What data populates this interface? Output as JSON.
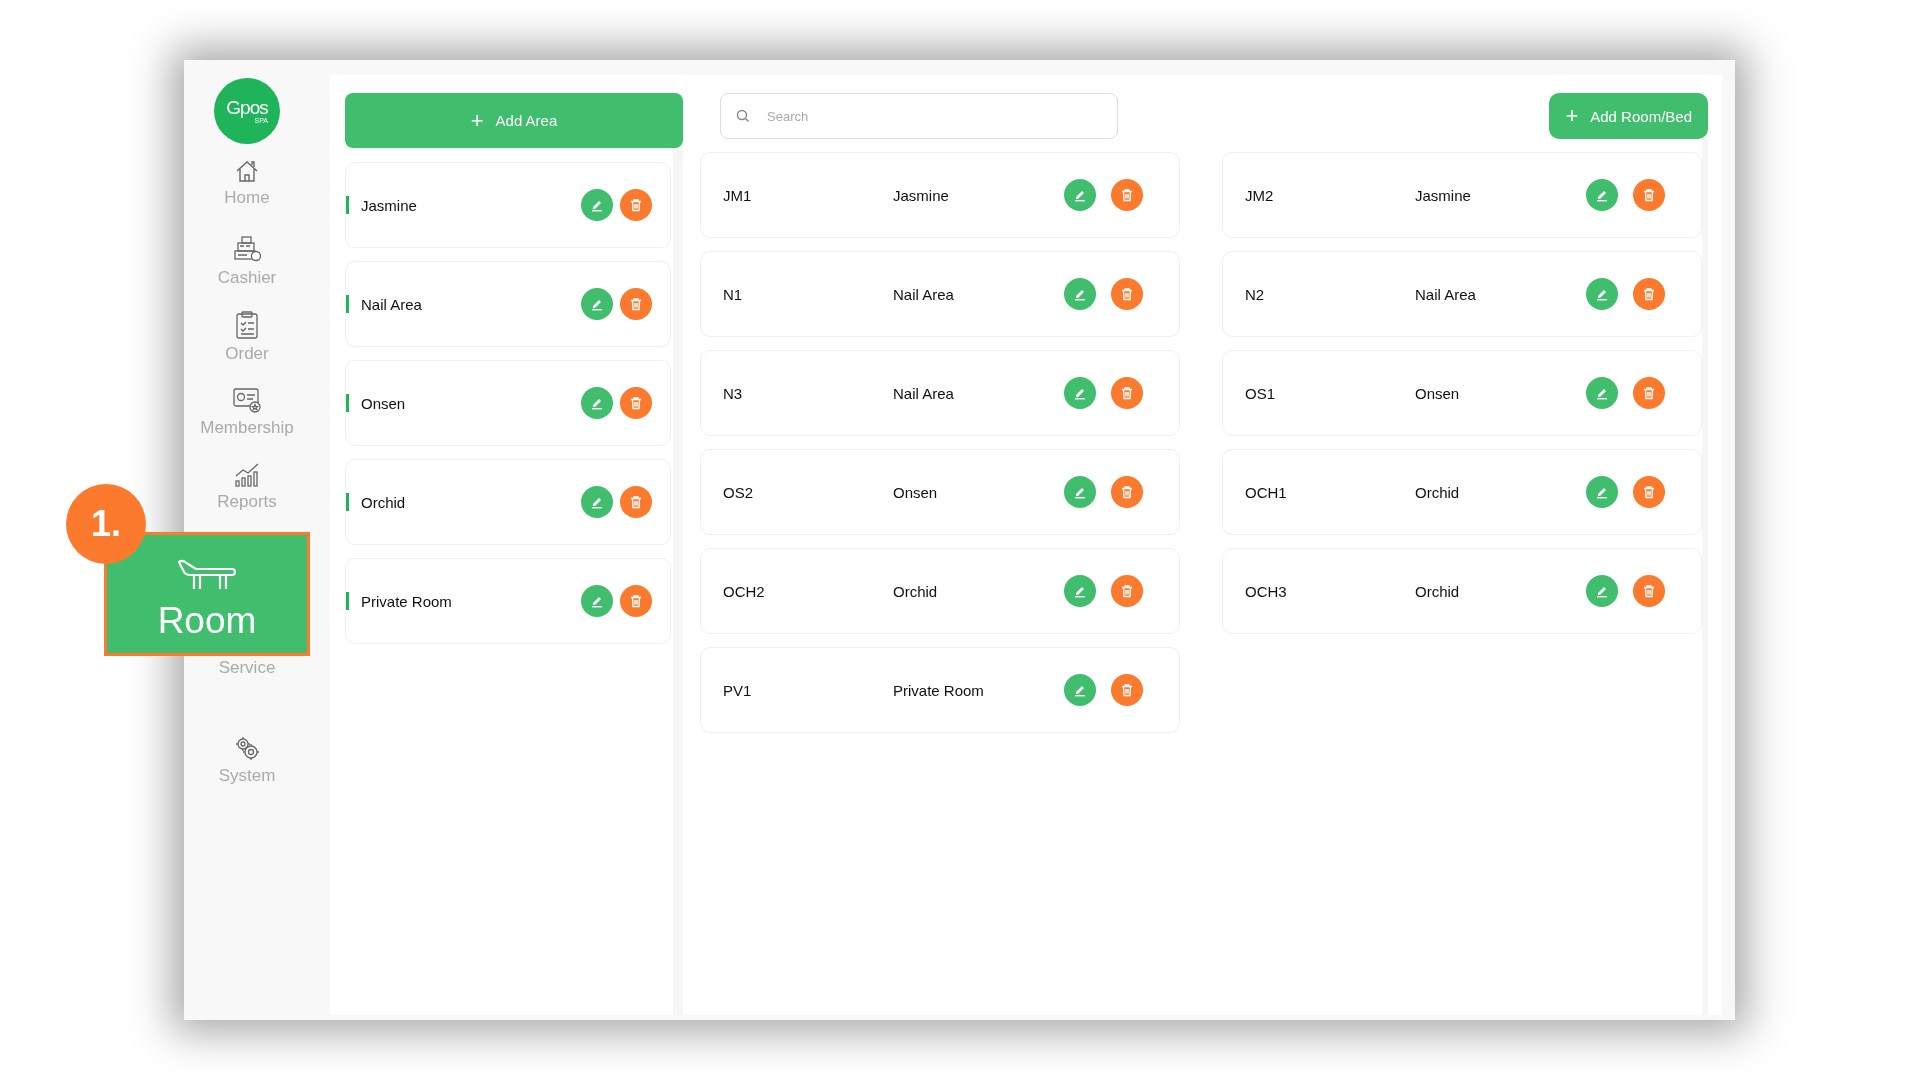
{
  "sidebar": {
    "logo": {
      "name": "Gpos",
      "tag": "SPA"
    },
    "items": [
      {
        "label": "Home",
        "kind": "home",
        "selected": false
      },
      {
        "label": "Cashier",
        "kind": "cashier",
        "selected": false
      },
      {
        "label": "Order",
        "kind": "order",
        "selected": false
      },
      {
        "label": "Membership",
        "kind": "membership",
        "selected": false
      },
      {
        "label": "Reports",
        "kind": "reports",
        "selected": false
      },
      {
        "label": "Room",
        "kind": "room",
        "selected": true
      },
      {
        "label": "Service",
        "kind": "service",
        "selected": false
      },
      {
        "label": "System",
        "kind": "system",
        "selected": false
      }
    ]
  },
  "callout": {
    "number": "1."
  },
  "add_area_button": {
    "label": "Add Area",
    "icon": "+"
  },
  "search": {
    "placeholder": "Search"
  },
  "add_room_button": {
    "label": "Add Room/Bed",
    "icon": "+"
  },
  "areas": [
    {
      "name": "Jasmine"
    },
    {
      "name": "Nail Area"
    },
    {
      "name": "Onsen"
    },
    {
      "name": "Orchid"
    },
    {
      "name": "Private Room"
    }
  ],
  "rooms": [
    {
      "code": "JM1",
      "area": "Jasmine"
    },
    {
      "code": "JM2",
      "area": "Jasmine"
    },
    {
      "code": "N1",
      "area": "Nail Area"
    },
    {
      "code": "N2",
      "area": "Nail Area"
    },
    {
      "code": "N3",
      "area": "Nail Area"
    },
    {
      "code": "OS1",
      "area": "Onsen"
    },
    {
      "code": "OS2",
      "area": "Onsen"
    },
    {
      "code": "OCH1",
      "area": "Orchid"
    },
    {
      "code": "OCH2",
      "area": "Orchid"
    },
    {
      "code": "OCH3",
      "area": "Orchid"
    },
    {
      "code": "PV1",
      "area": "Private Room"
    }
  ]
}
